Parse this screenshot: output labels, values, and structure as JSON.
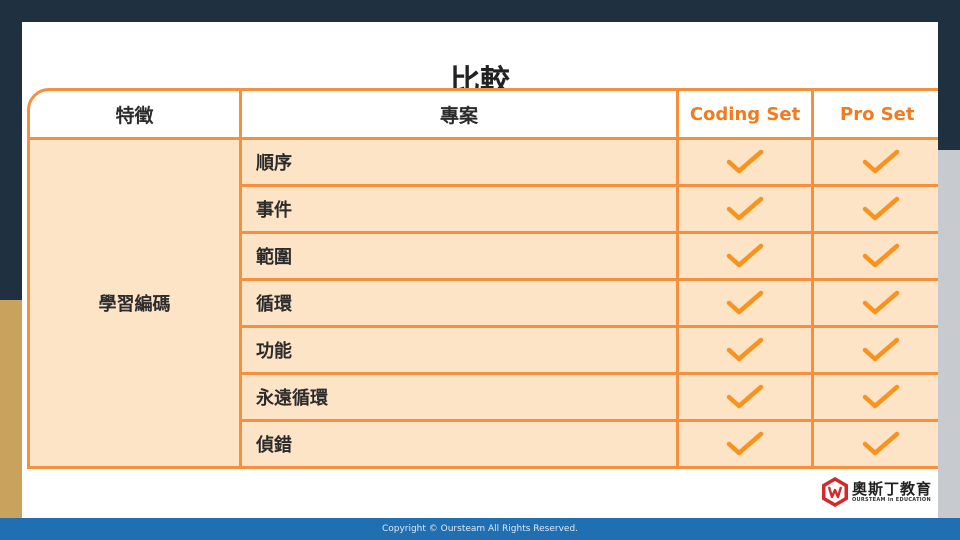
{
  "slide": {
    "title": "比較"
  },
  "table": {
    "headers": {
      "feature": "特徵",
      "project": "專案",
      "product1": "Coding Set",
      "product2": "Pro Set"
    },
    "feature_group": "學習編碼",
    "rows": [
      {
        "project": "順序",
        "product1": true,
        "product2": true
      },
      {
        "project": "事件",
        "product1": true,
        "product2": true
      },
      {
        "project": "範圍",
        "product1": true,
        "product2": true
      },
      {
        "project": "循環",
        "product1": true,
        "product2": true
      },
      {
        "project": "功能",
        "product1": true,
        "product2": true
      },
      {
        "project": "永遠循環",
        "product1": true,
        "product2": true
      },
      {
        "project": "偵錯",
        "product1": true,
        "product2": true
      }
    ]
  },
  "colors": {
    "accent": "#f5903f",
    "cell_bg": "#fde4c6",
    "product_text": "#f27a1f",
    "footer_bg": "#1f6fb2"
  },
  "logo": {
    "name": "奧斯丁教育",
    "tagline": "OURSTEAM in EDUCATION"
  },
  "footer": {
    "copyright": "Copyright © Oursteam All Rights Reserved."
  }
}
